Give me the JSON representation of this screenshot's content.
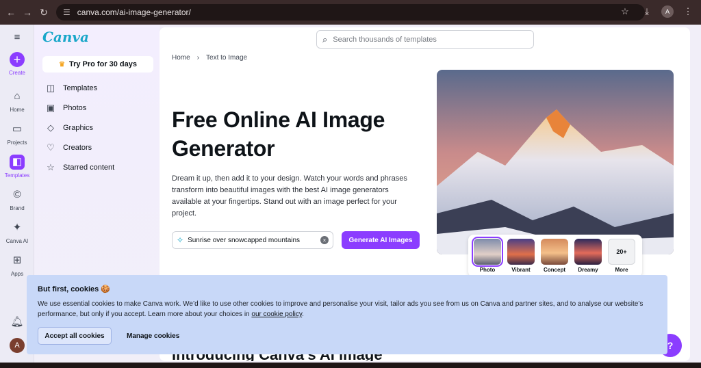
{
  "browser": {
    "url": "canva.com/ai-image-generator/",
    "avatar_letter": "A"
  },
  "rail": {
    "items": [
      {
        "label": "Create"
      },
      {
        "label": "Home"
      },
      {
        "label": "Projects"
      },
      {
        "label": "Templates"
      },
      {
        "label": "Brand"
      },
      {
        "label": "Canva AI"
      },
      {
        "label": "Apps"
      }
    ],
    "user_avatar": "A"
  },
  "panel": {
    "logo": "Canva",
    "try_pro": "Try Pro for 30 days",
    "menu": [
      {
        "label": "Templates",
        "icon": "template-icon"
      },
      {
        "label": "Photos",
        "icon": "photo-icon"
      },
      {
        "label": "Graphics",
        "icon": "graphics-icon"
      },
      {
        "label": "Creators",
        "icon": "heart-icon"
      },
      {
        "label": "Starred content",
        "icon": "star-icon"
      }
    ]
  },
  "main": {
    "search_placeholder": "Search thousands of templates",
    "breadcrumb": [
      "Home",
      "Text to Image"
    ],
    "title": "Free Online AI Image Generator",
    "description": "Dream it up, then add it to your design. Watch your words and phrases transform into beautiful images with the best AI image generators available at your fingertips. Stand out with an image perfect for your project.",
    "prompt_value": "Sunrise over snowcapped mountains",
    "generate_label": "Generate AI Images",
    "styles": [
      {
        "label": "Photo",
        "selected": true
      },
      {
        "label": "Vibrant"
      },
      {
        "label": "Concept"
      },
      {
        "label": "Dreamy"
      },
      {
        "label": "More",
        "thumb_text": "20+"
      }
    ],
    "intro_heading": "Introducing Canva's AI image"
  },
  "cookie": {
    "title": "But first, cookies 🍪",
    "body": "We use essential cookies to make Canva work. We’d like to use other cookies to improve and personalise your visit, tailor ads you see from us on Canva and partner sites, and to analyse our website’s performance, but only if you accept. Learn more about your choices in ",
    "link": "our cookie policy",
    "accept": "Accept all cookies",
    "manage": "Manage cookies"
  },
  "help_label": "?",
  "colors": {
    "accent": "#8b3dff",
    "cookie_bg": "#c8d8f8",
    "logo": "#1aa7c9"
  }
}
